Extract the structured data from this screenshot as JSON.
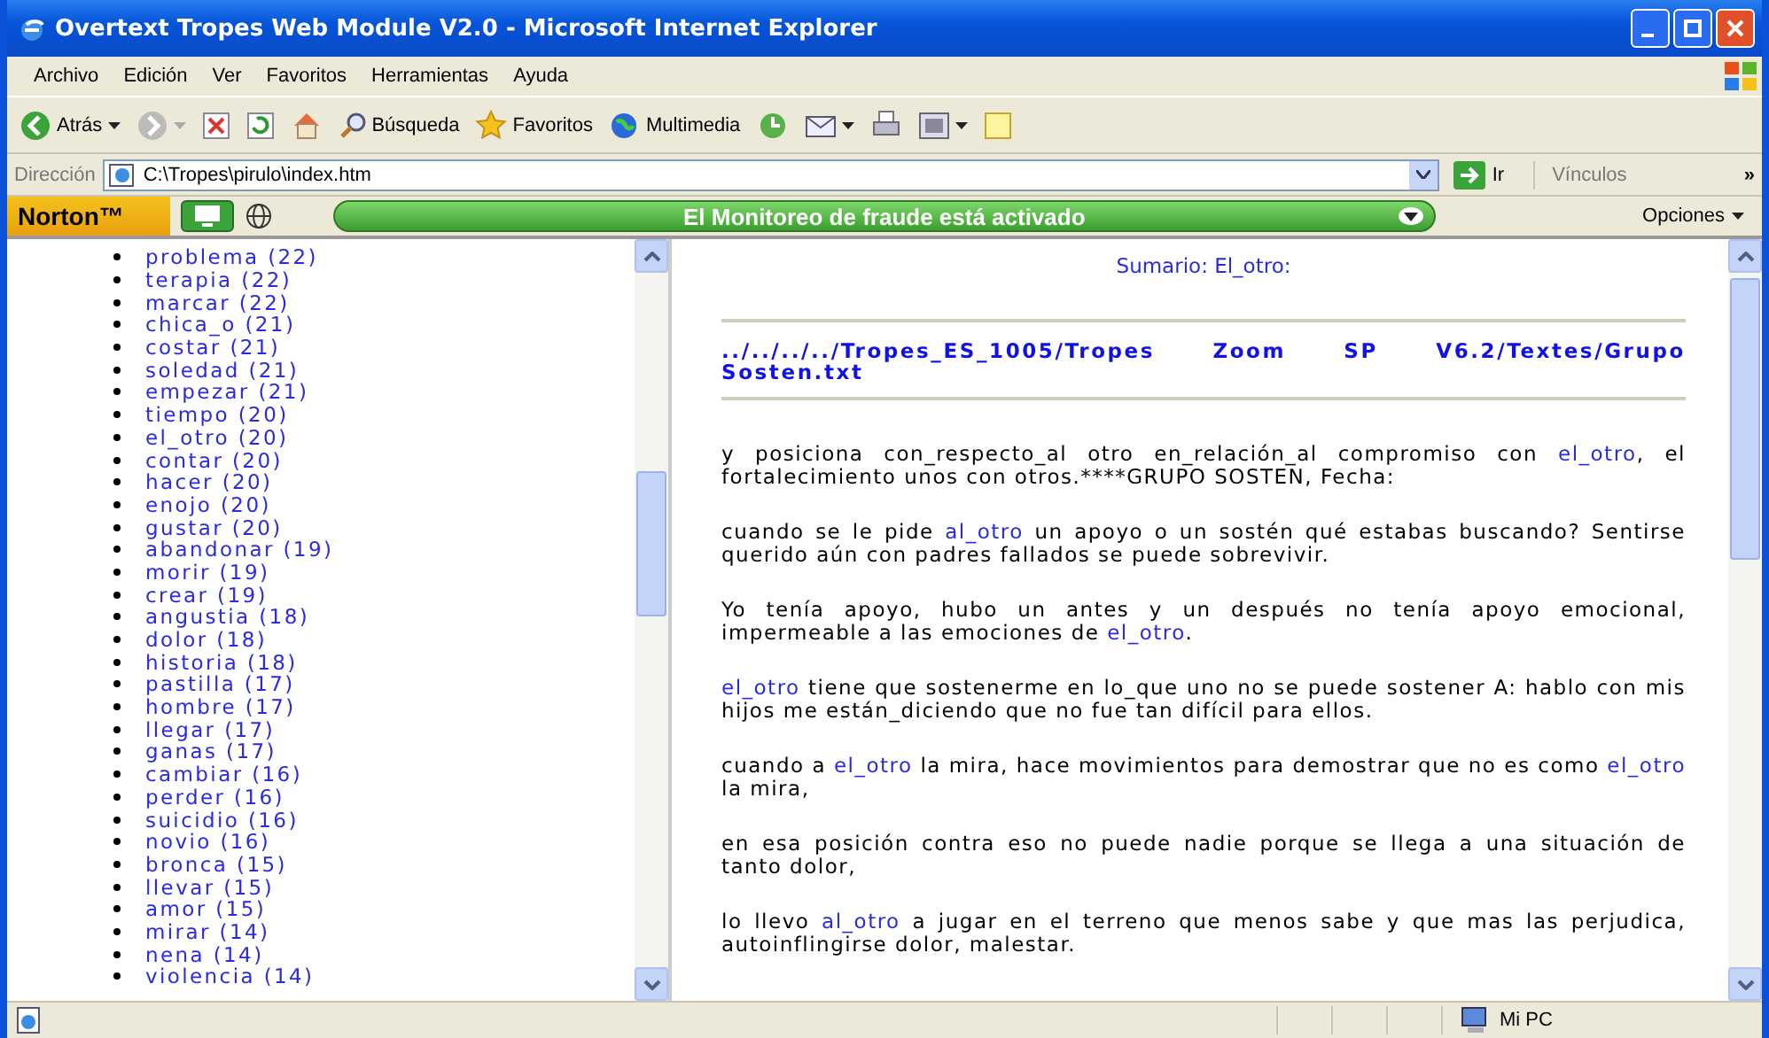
{
  "window": {
    "title": "Overtext Tropes Web Module V2.0 - Microsoft Internet Explorer"
  },
  "menu": [
    "Archivo",
    "Edición",
    "Ver",
    "Favoritos",
    "Herramientas",
    "Ayuda"
  ],
  "toolbar": [
    {
      "kind": "back",
      "label": "Atrás"
    },
    {
      "kind": "forward"
    },
    {
      "kind": "stop"
    },
    {
      "kind": "refresh"
    },
    {
      "kind": "home"
    },
    {
      "kind": "search",
      "label": "Búsqueda"
    },
    {
      "kind": "favorites",
      "label": "Favoritos"
    },
    {
      "kind": "media",
      "label": "Multimedia"
    },
    {
      "kind": "history"
    },
    {
      "kind": "mail"
    },
    {
      "kind": "print"
    },
    {
      "kind": "edit"
    },
    {
      "kind": "notes"
    }
  ],
  "address": {
    "label": "Dirección",
    "value": "C:\\Tropes\\pirulo\\index.htm",
    "go": "Ir",
    "links": "Vínculos",
    "more": "»"
  },
  "norton": {
    "brand": "Norton™",
    "status": "El Monitoreo de fraude está activado",
    "options": "Opciones"
  },
  "word_list": [
    "problema (22)",
    "terapia (22)",
    "marcar (22)",
    "chica_o (21)",
    "costar (21)",
    "soledad (21)",
    "empezar (21)",
    "tiempo (20)",
    "el_otro (20)",
    "contar (20)",
    "hacer (20)",
    "enojo (20)",
    "gustar (20)",
    "abandonar (19)",
    "morir (19)",
    "crear (19)",
    "angustia (18)",
    "dolor (18)",
    "historia (18)",
    "pastilla (17)",
    "hombre (17)",
    "llegar (17)",
    "ganas (17)",
    "cambiar (16)",
    "perder (16)",
    "suicidio (16)",
    "novio (16)",
    "bronca (15)",
    "llevar (15)",
    "amor (15)",
    "mirar (14)",
    "nena (14)",
    "violencia (14)"
  ],
  "document": {
    "title": "Sumario: El_otro:",
    "file_path": "../../../../Tropes_ES_1005/Tropes Zoom SP V6.2/Textes/Grupo Sosten.txt",
    "paragraphs": [
      [
        {
          "text": "y posiciona con_respecto_al otro en_relación_al compromiso con ",
          "link": false
        },
        {
          "text": "el_otro",
          "link": true
        },
        {
          "text": ", el fortalecimiento unos con otros.****GRUPO SOSTEN, Fecha:",
          "link": false
        }
      ],
      [
        {
          "text": "cuando se le pide ",
          "link": false
        },
        {
          "text": "al_otro",
          "link": true
        },
        {
          "text": " un apoyo o un sostén qué estabas buscando? Sentirse querido aún con padres fallados se puede sobrevivir.",
          "link": false
        }
      ],
      [
        {
          "text": "Yo tenía apoyo, hubo un antes y un después no tenía apoyo emocional, impermeable a las emociones de ",
          "link": false
        },
        {
          "text": "el_otro",
          "link": true
        },
        {
          "text": ".",
          "link": false
        }
      ],
      [
        {
          "text": "el_otro",
          "link": true
        },
        {
          "text": " tiene que sostenerme en lo_que uno no se puede sostener A: hablo con mis hijos me están_diciendo que no fue tan difícil para ellos.",
          "link": false
        }
      ],
      [
        {
          "text": "cuando a ",
          "link": false
        },
        {
          "text": "el_otro",
          "link": true
        },
        {
          "text": " la mira, hace movimientos para demostrar que no es como ",
          "link": false
        },
        {
          "text": "el_otro",
          "link": true
        },
        {
          "text": " la mira,",
          "link": false
        }
      ],
      [
        {
          "text": "en esa posición contra eso no puede nadie porque se llega a una situación de tanto dolor,",
          "link": false
        }
      ],
      [
        {
          "text": "lo llevo ",
          "link": false
        },
        {
          "text": "al_otro",
          "link": true
        },
        {
          "text": " a jugar en el terreno que menos sabe y que mas las perjudica, autoinflingirse dolor, malestar.",
          "link": false
        }
      ]
    ]
  },
  "status_bar": {
    "zone": "Mi PC"
  }
}
